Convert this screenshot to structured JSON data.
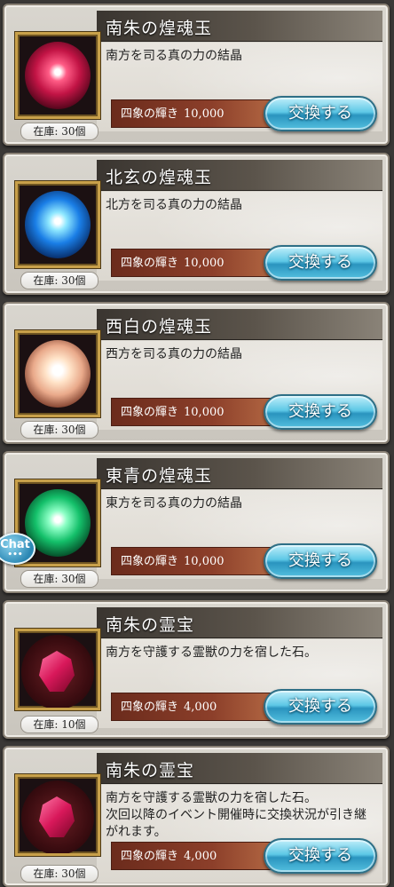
{
  "items": [
    {
      "title": "南朱の煌魂玉",
      "description": "南方を司る真の力の結晶",
      "cost_label": "四象の輝き",
      "cost_value": "10,000",
      "button": "交換する",
      "stock": "在庫: 30個",
      "icon": "red-orb-icon"
    },
    {
      "title": "北玄の煌魂玉",
      "description": "北方を司る真の力の結晶",
      "cost_label": "四象の輝き",
      "cost_value": "10,000",
      "button": "交換する",
      "stock": "在庫: 30個",
      "icon": "blue-orb-icon"
    },
    {
      "title": "西白の煌魂玉",
      "description": "西方を司る真の力の結晶",
      "cost_label": "四象の輝き",
      "cost_value": "10,000",
      "button": "交換する",
      "stock": "在庫: 30個",
      "icon": "white-orb-icon"
    },
    {
      "title": "東青の煌魂玉",
      "description": "東方を司る真の力の結晶",
      "cost_label": "四象の輝き",
      "cost_value": "10,000",
      "button": "交換する",
      "stock": "在庫: 30個",
      "icon": "green-orb-icon"
    },
    {
      "title": "南朱の霊宝",
      "description": "南方を守護する霊獣の力を宿した石。",
      "cost_label": "四象の輝き",
      "cost_value": "4,000",
      "button": "交換する",
      "stock": "在庫: 10個",
      "icon": "red-gem-icon"
    },
    {
      "title": "南朱の霊宝",
      "description": "南方を守護する霊獣の力を宿した石。\n次回以降のイベント開催時に交換状況が引き継がれます。",
      "cost_label": "四象の輝き",
      "cost_value": "4,000",
      "button": "交換する",
      "stock": "在庫: 30個",
      "icon": "red-gem-icon"
    }
  ],
  "chat": {
    "label": "Chat",
    "dots": "•••"
  }
}
